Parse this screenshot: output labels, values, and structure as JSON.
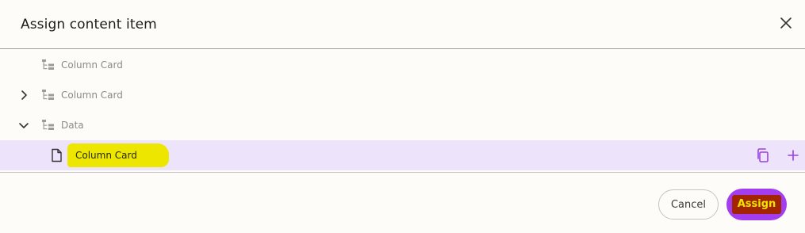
{
  "dialog": {
    "title": "Assign content item",
    "close_icon": "close-icon"
  },
  "tree": {
    "items": [
      {
        "label": "Column Card",
        "icon": "structure-icon",
        "expander": "none"
      },
      {
        "label": "Column Card",
        "icon": "structure-icon",
        "expander": "collapsed"
      },
      {
        "label": "Data",
        "icon": "structure-icon",
        "expander": "expanded"
      },
      {
        "label": "Column Card",
        "icon": "document-icon",
        "expander": "none",
        "selected": true,
        "highlighted": true
      }
    ],
    "row_actions": [
      "copy-icon",
      "add-icon"
    ]
  },
  "footer": {
    "cancel_label": "Cancel",
    "assign_label": "Assign"
  },
  "colors": {
    "accent": "#a33ef0",
    "selected_row": "#ede3fa",
    "highlight": "#ede600",
    "assign_text_bg": "#a32400",
    "background": "#fdfcf9"
  }
}
